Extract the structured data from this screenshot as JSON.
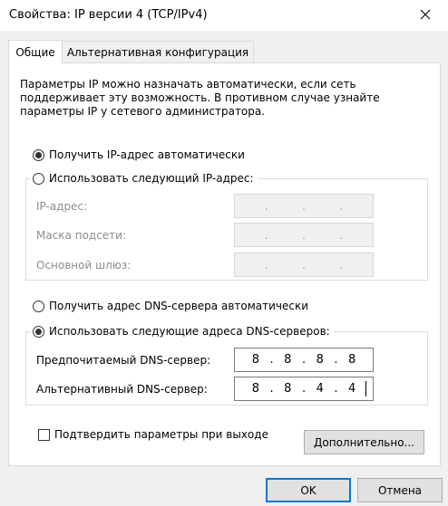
{
  "window": {
    "title": "Свойства: IP версии 4 (TCP/IPv4)",
    "close_icon": "close-icon"
  },
  "tabs": [
    {
      "label": "Общие",
      "active": true
    },
    {
      "label": "Альтернативная конфигурация",
      "active": false
    }
  ],
  "description": "Параметры IP можно назначать автоматически, если сеть поддерживает эту возможность. В противном случае узнайте параметры IP у сетевого администратора.",
  "ip_section": {
    "auto_radio_label": "Получить IP-адрес автоматически",
    "manual_radio_label": "Использовать следующий IP-адрес:",
    "auto_selected": true,
    "fields": [
      {
        "label": "IP-адрес:",
        "octets": [
          "",
          "",
          "",
          ""
        ],
        "enabled": false
      },
      {
        "label": "Маска подсети:",
        "octets": [
          "",
          "",
          "",
          ""
        ],
        "enabled": false
      },
      {
        "label": "Основной шлюз:",
        "octets": [
          "",
          "",
          "",
          ""
        ],
        "enabled": false
      }
    ]
  },
  "dns_section": {
    "auto_radio_label": "Получить адрес DNS-сервера автоматически",
    "manual_radio_label": "Использовать следующие адреса DNS-серверов:",
    "manual_selected": true,
    "preferred": {
      "label": "Предпочитаемый DNS-сервер:",
      "octets": [
        "8",
        "8",
        "8",
        "8"
      ]
    },
    "alternate": {
      "label": "Альтернативный DNS-сервер:",
      "octets": [
        "8",
        "8",
        "4",
        "4"
      ]
    }
  },
  "validate_checkbox": {
    "label": "Подтвердить параметры при выходе",
    "checked": false
  },
  "buttons": {
    "advanced": "Дополнительно...",
    "ok": "OK",
    "cancel": "Отмена"
  },
  "colors": {
    "accent": "#0078d7",
    "dialog_bg": "#f0f0f0",
    "panel_bg": "#ffffff"
  }
}
